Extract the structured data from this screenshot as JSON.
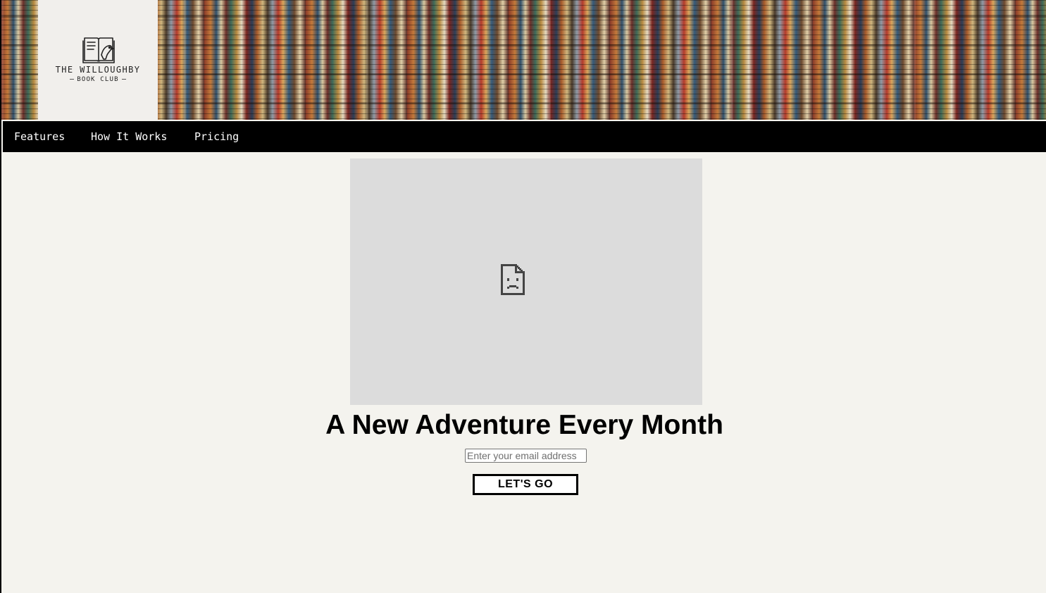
{
  "header": {
    "background_image": "bookshelf-pattern",
    "logo": {
      "icon": "book-bird-icon",
      "title": "THE WILLOUGHBY",
      "subtitle": "BOOK CLUB"
    }
  },
  "nav": {
    "items": [
      {
        "label": "Features"
      },
      {
        "label": "How It Works"
      },
      {
        "label": "Pricing"
      }
    ]
  },
  "main": {
    "video_placeholder_icon": "broken-page-icon",
    "headline": "A New Adventure Every Month",
    "email": {
      "value": "",
      "placeholder": "Enter your email address"
    },
    "submit_label": "LET'S GO"
  },
  "colors": {
    "page_background": "#f4f3ee",
    "nav_background": "#000000",
    "logo_background": "#f1efec",
    "video_placeholder": "#dcdcdc"
  }
}
